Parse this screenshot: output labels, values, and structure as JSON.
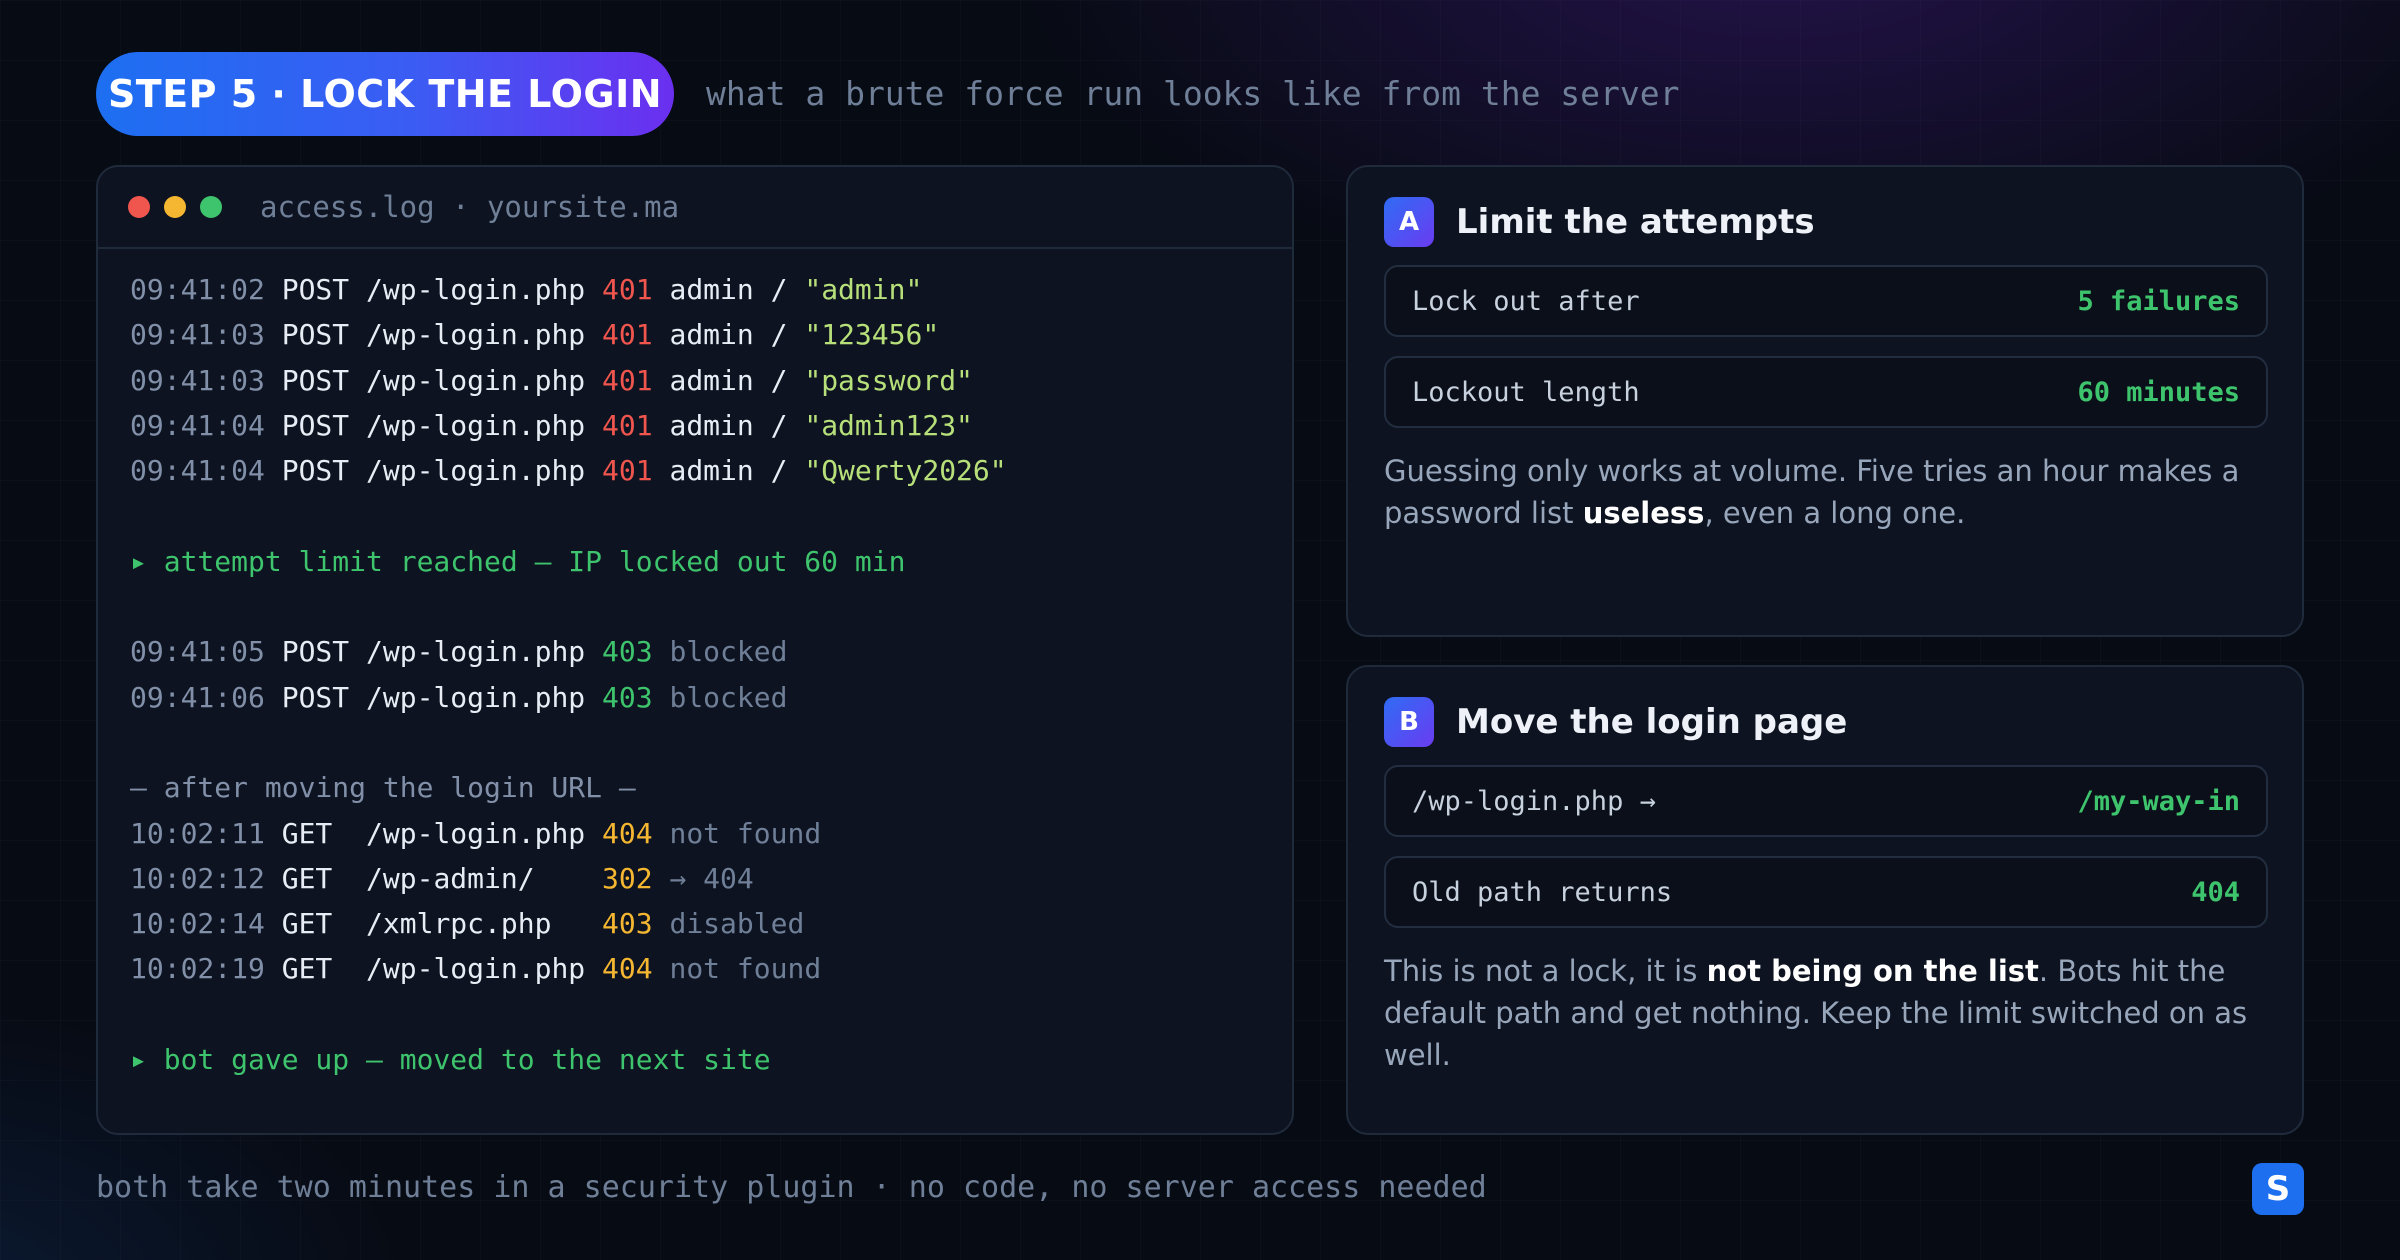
{
  "header": {
    "step_label": "STEP 5 · LOCK THE LOGIN",
    "subtitle": "what a brute force run looks like from the server"
  },
  "terminal": {
    "title": "access.log · yoursite.ma",
    "window_dots": [
      "#f0554e",
      "#f5b731",
      "#3ec46d"
    ],
    "attempts": [
      {
        "time": "09:41:02",
        "method": "POST",
        "path": "/wp-login.php",
        "status": "401",
        "user": "admin",
        "slash": "/",
        "password": "\"admin\""
      },
      {
        "time": "09:41:03",
        "method": "POST",
        "path": "/wp-login.php",
        "status": "401",
        "user": "admin",
        "slash": "/",
        "password": "\"123456\""
      },
      {
        "time": "09:41:03",
        "method": "POST",
        "path": "/wp-login.php",
        "status": "401",
        "user": "admin",
        "slash": "/",
        "password": "\"password\""
      },
      {
        "time": "09:41:04",
        "method": "POST",
        "path": "/wp-login.php",
        "status": "401",
        "user": "admin",
        "slash": "/",
        "password": "\"admin123\""
      },
      {
        "time": "09:41:04",
        "method": "POST",
        "path": "/wp-login.php",
        "status": "401",
        "user": "admin",
        "slash": "/",
        "password": "\"Qwerty2026\""
      }
    ],
    "limit_note": "▸ attempt limit reached — IP locked out 60 min",
    "blocked": [
      {
        "time": "09:41:05",
        "method": "POST",
        "path": "/wp-login.php",
        "status": "403",
        "detail": "blocked"
      },
      {
        "time": "09:41:06",
        "method": "POST",
        "path": "/wp-login.php",
        "status": "403",
        "detail": "blocked"
      }
    ],
    "separator": "— after moving the login URL —",
    "after": [
      {
        "time": "10:02:11",
        "method": "GET ",
        "path": "/wp-login.php",
        "status": "404",
        "detail": "not found"
      },
      {
        "time": "10:02:12",
        "method": "GET ",
        "path": "/wp-admin/   ",
        "status": "302",
        "detail": "→ 404"
      },
      {
        "time": "10:02:14",
        "method": "GET ",
        "path": "/xmlrpc.php  ",
        "status": "403",
        "detail": "disabled"
      },
      {
        "time": "10:02:19",
        "method": "GET ",
        "path": "/wp-login.php",
        "status": "404",
        "detail": "not found"
      }
    ],
    "final_note": "▸ bot gave up — moved to the next site"
  },
  "card_a": {
    "badge": "A",
    "title": "Limit the attempts",
    "rows": [
      {
        "label": "Lock out after",
        "value": "5 failures"
      },
      {
        "label": "Lockout length",
        "value": "60 minutes"
      }
    ],
    "desc_before": "Guessing only works at volume. Five tries an hour makes a password list ",
    "desc_bold": "useless",
    "desc_after": ", even a long one."
  },
  "card_b": {
    "badge": "B",
    "title": "Move the login page",
    "rows": [
      {
        "label": "/wp-login.php →",
        "value": "/my-way-in"
      },
      {
        "label": "Old path returns",
        "value": "404"
      }
    ],
    "desc_before": "This is not a lock, it is ",
    "desc_bold": "not being on the list",
    "desc_after": ". Bots hit the default path and get nothing. Keep the limit switched on as well."
  },
  "footer": {
    "text": "both take two minutes in a security plugin · no code, no server access needed",
    "logo_letter": "S"
  }
}
